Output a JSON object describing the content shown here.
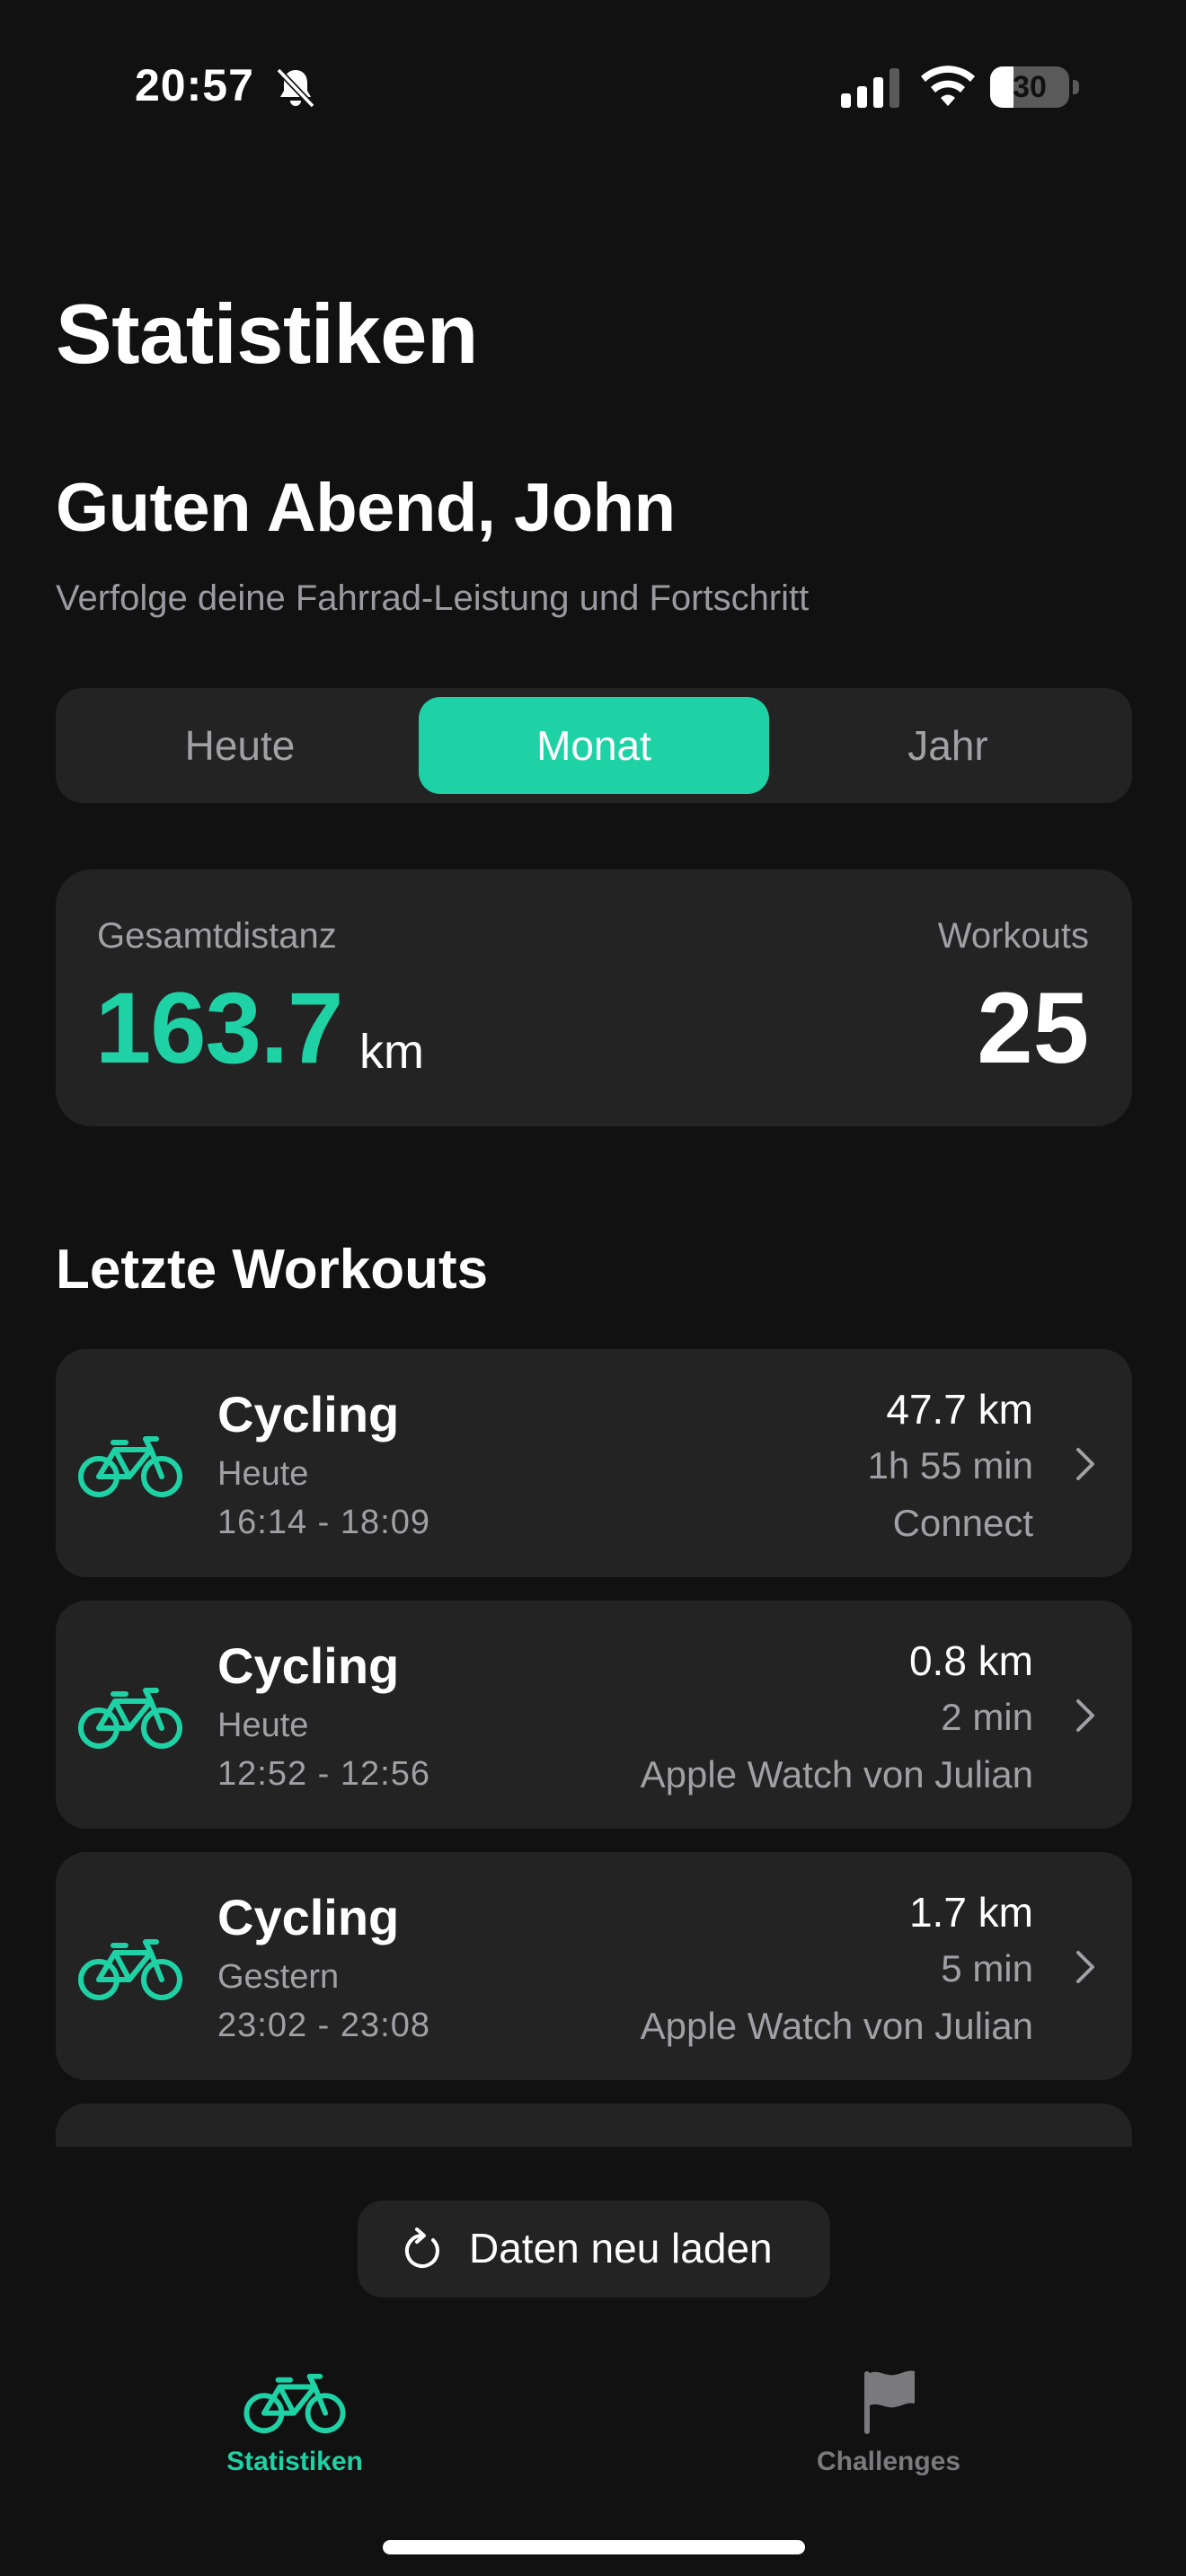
{
  "status_bar": {
    "time": "20:57",
    "battery": "30",
    "battery_level_percent": 30
  },
  "page": {
    "title": "Statistiken",
    "greeting": "Guten Abend, John",
    "subtitle": "Verfolge deine Fahrrad-Leistung und Fortschritt"
  },
  "period_selector": {
    "options": [
      "Heute",
      "Monat",
      "Jahr"
    ],
    "selected": "Monat"
  },
  "summary": {
    "distance_label": "Gesamtdistanz",
    "distance_value": "163.7",
    "distance_unit": "km",
    "workouts_label": "Workouts",
    "workouts_value": "25"
  },
  "recent": {
    "title": "Letzte Workouts",
    "items": [
      {
        "type": "Cycling",
        "day": "Heute",
        "time": "16:14 - 18:09",
        "distance": "47.7 km",
        "duration": "1h 55 min",
        "source": "Connect"
      },
      {
        "type": "Cycling",
        "day": "Heute",
        "time": "12:52 - 12:56",
        "distance": "0.8 km",
        "duration": "2 min",
        "source": "Apple Watch von Julian"
      },
      {
        "type": "Cycling",
        "day": "Gestern",
        "time": "23:02 - 23:08",
        "distance": "1.7 km",
        "duration": "5 min",
        "source": "Apple Watch von Julian"
      }
    ]
  },
  "reload_button": {
    "label": "Daten neu laden"
  },
  "tab_bar": {
    "items": [
      {
        "label": "Statistiken",
        "icon": "bicycle-icon",
        "active": true
      },
      {
        "label": "Challenges",
        "icon": "flag-icon",
        "active": false
      }
    ]
  },
  "colors": {
    "accent": "#1fd2a5",
    "background": "#111111",
    "card": "#232324",
    "secondary_text": "#a0a0a5"
  }
}
